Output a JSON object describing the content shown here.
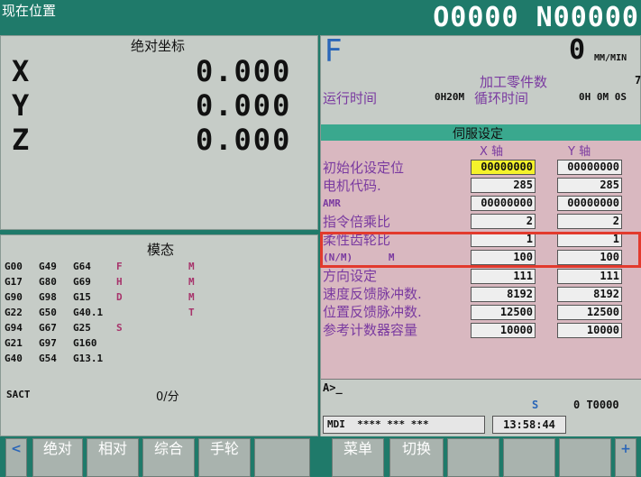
{
  "header": {
    "title": "现在位置",
    "program_number": "O0000 N00000"
  },
  "position": {
    "title": "绝对坐标",
    "axes": [
      {
        "name": "X",
        "value": "0.000"
      },
      {
        "name": "Y",
        "value": "0.000"
      },
      {
        "name": "Z",
        "value": "0.000"
      }
    ]
  },
  "modal": {
    "title": "模态",
    "rows": [
      {
        "c1": "G00",
        "c2": "G49",
        "c3": "G64",
        "letter": "F",
        "m": "M"
      },
      {
        "c1": "G17",
        "c2": "G80",
        "c3": "G69",
        "letter": "H",
        "m": "M"
      },
      {
        "c1": "G90",
        "c2": "G98",
        "c3": "G15",
        "letter": "D",
        "m": "M"
      },
      {
        "c1": "G22",
        "c2": "G50",
        "c3": "G40.1",
        "letter": "",
        "m": "T"
      },
      {
        "c1": "G94",
        "c2": "G67",
        "c3": "G25",
        "letter": "S",
        "m": ""
      },
      {
        "c1": "G21",
        "c2": "G97",
        "c3": "G160",
        "letter": "",
        "m": ""
      },
      {
        "c1": "G40",
        "c2": "G54",
        "c3": "G13.1",
        "letter": "",
        "m": ""
      }
    ],
    "sact_label": "SACT",
    "sact_value": "0/分"
  },
  "feed": {
    "label": "F",
    "value": "0",
    "unit": "MM/MIN",
    "parts_label": "加工零件数",
    "parts_value": "7",
    "run_time_label": "运行时间",
    "run_time_value": "0H20M",
    "cycle_time_label": "循环时间",
    "cycle_time_value": "0H 0M 0S"
  },
  "servo": {
    "title": "伺服设定",
    "col_x": "X 轴",
    "col_y": "Y 轴",
    "params": [
      {
        "label": "初始化设定位",
        "x": "00000000",
        "y": "00000000"
      },
      {
        "label": "电机代码.",
        "x": "285",
        "y": "285"
      },
      {
        "label": "AMR",
        "x": "00000000",
        "y": "00000000"
      },
      {
        "label": "指令倍乘比",
        "x": "2",
        "y": "2"
      },
      {
        "label": "柔性齿轮比",
        "x": "1",
        "y": "1"
      },
      {
        "label": "(N/M)      M",
        "x": "100",
        "y": "100"
      },
      {
        "label": "方向设定",
        "x": "111",
        "y": "111"
      },
      {
        "label": "速度反馈脉冲数.",
        "x": "8192",
        "y": "8192"
      },
      {
        "label": "位置反馈脉冲数.",
        "x": "12500",
        "y": "12500"
      },
      {
        "label": "参考计数器容量",
        "x": "10000",
        "y": "10000"
      }
    ]
  },
  "input_line": "A>_",
  "status": {
    "spindle": "S",
    "tool": "0 T0000",
    "mode": "MDI  **** *** ***",
    "time": "13:58:44"
  },
  "softkeys": {
    "left_arrow": "<",
    "k1": "绝对",
    "k2": "相对",
    "k3": "综合",
    "k4": "手轮",
    "k5": "",
    "k6": "菜单",
    "k7": "切换",
    "k8": "",
    "k9": "",
    "k10": "",
    "right_arrow": "+"
  },
  "colors": {
    "background": "#1f7a6a",
    "panel": "#c6ccc7",
    "servo_bg": "#d9b8c0",
    "highlight": "#e23a2d"
  }
}
